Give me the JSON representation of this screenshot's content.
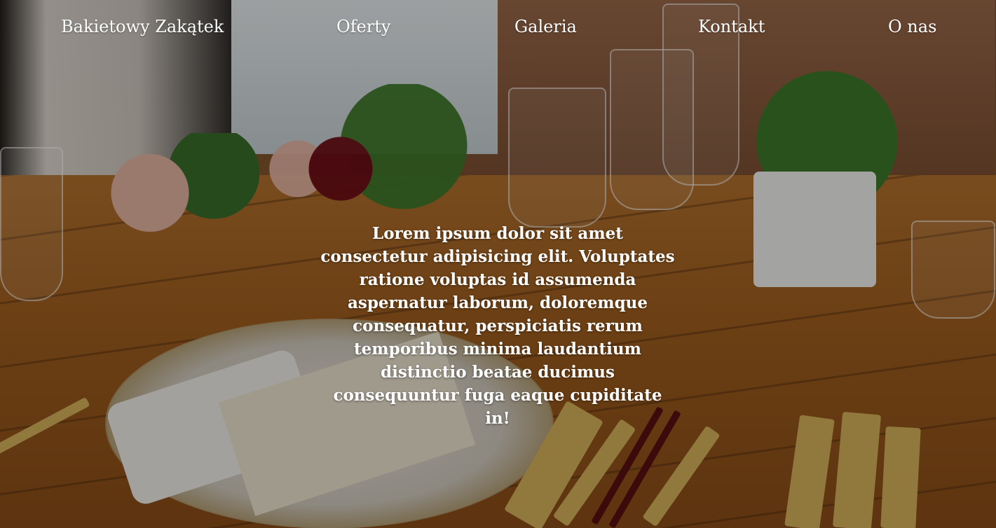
{
  "nav": {
    "brand": "Bakietowy Zakątek",
    "items": [
      {
        "label": "Oferty"
      },
      {
        "label": "Galeria"
      },
      {
        "label": "Kontakt"
      },
      {
        "label": "O nas"
      }
    ]
  },
  "hero": {
    "text": "Lorem ipsum dolor sit amet consectetur adipisicing elit. Voluptates ratione voluptas id assumenda aspernatur laborum, doloremque consequatur, perspiciatis rerum temporibus minima laudantium distinctio beatae ducimus consequuntur fuga eaque cupiditate in!"
  },
  "colors": {
    "text": "#ffffff",
    "overlay": "rgba(0,0,0,0.33)"
  }
}
